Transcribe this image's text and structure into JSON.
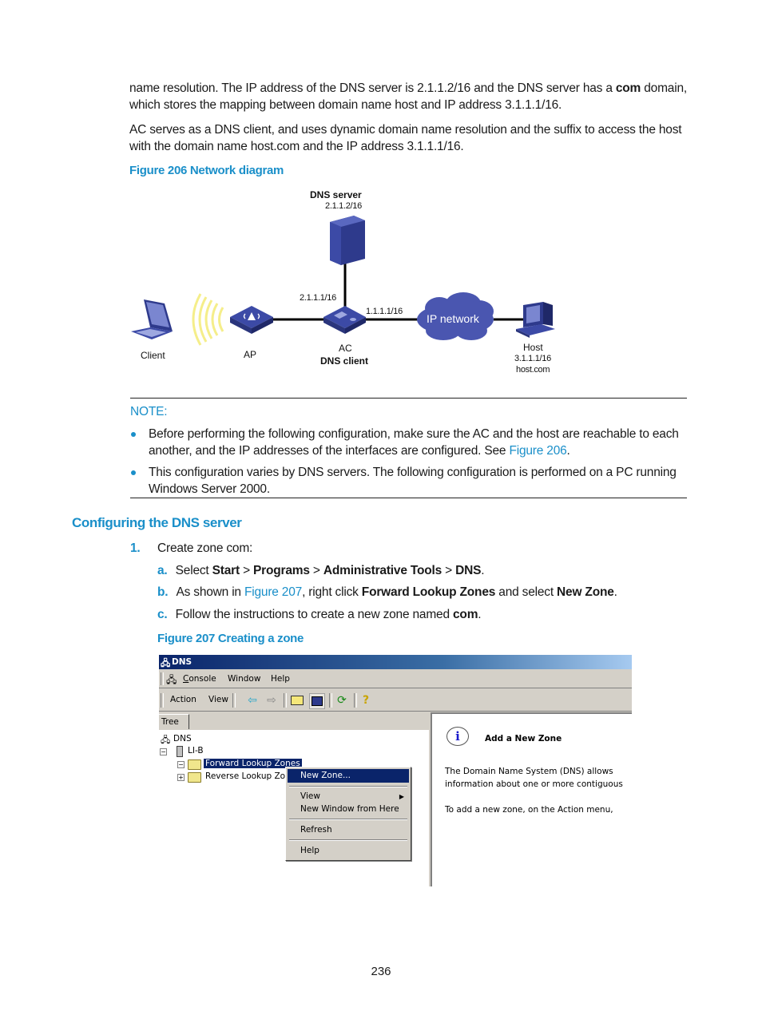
{
  "intro": {
    "p1_a": "name resolution. The IP address of the DNS server is 2.1.1.2/16 and the DNS server has a ",
    "p1_bold": "com",
    "p1_b": " domain,",
    "p1_line2": "which stores the mapping between domain name host and IP address 3.1.1.1/16.",
    "p2_line1": "AC serves as a DNS client, and uses dynamic domain name resolution and the suffix to access the host",
    "p2_line2": "with the domain name host.com and the IP address 3.1.1.1/16."
  },
  "figure206": {
    "caption": "Figure 206 Network diagram",
    "dns_server_label": "DNS server",
    "dns_server_ip": "2.1.1.2/16",
    "ac_ip_left": "2.1.1.1/16",
    "ac_ip_right": "1.1.1.1/16",
    "cloud_label": "IP network",
    "client_label": "Client",
    "ap_label": "AP",
    "ac_label": "AC",
    "ac_role": "DNS client",
    "host_label": "Host",
    "host_ip": "3.1.1.1/16",
    "host_name": "host.com"
  },
  "note": {
    "title": "NOTE:",
    "bullet1_line1": "Before performing the following configuration, make sure the AC and the host are reachable to each",
    "bullet1_line2_a": "another, and the IP addresses of the interfaces are configured. See ",
    "bullet1_link": "Figure 206",
    "bullet1_line2_b": ".",
    "bullet2_line1": "This configuration varies by DNS servers. The following configuration is performed on a PC running",
    "bullet2_line2": "Windows Server 2000."
  },
  "section": {
    "heading": "Configuring the DNS server",
    "step1_num": "1.",
    "step1_text": "Create zone com:",
    "a_num": "a.",
    "a_pre": "Select ",
    "a_start": "Start",
    "a_gt1": " > ",
    "a_programs": "Programs",
    "a_gt2": " > ",
    "a_tools": "Administrative Tools",
    "a_gt3": " > ",
    "a_dns": "DNS",
    "a_end": ".",
    "b_num": "b.",
    "b_pre": "As shown in ",
    "b_link": "Figure 207",
    "b_mid": ", right click ",
    "b_flz": "Forward Lookup Zones",
    "b_and": " and select ",
    "b_newzone": "New Zone",
    "b_end": ".",
    "c_num": "c.",
    "c_pre": "Follow the instructions to create a new zone named ",
    "c_com": "com",
    "c_end": "."
  },
  "figure207": {
    "caption": "Figure 207 Creating a zone",
    "window_title": "DNS",
    "menu": {
      "console": "Console",
      "window": "Window",
      "help": "Help"
    },
    "toolbar": {
      "action": "Action",
      "view": "View"
    },
    "tree_tab": "Tree",
    "tree": {
      "root": "DNS",
      "server": "LI-B",
      "forward": "Forward Lookup Zones",
      "reverse": "Reverse Lookup Zones"
    },
    "context_menu": {
      "new_zone": "New Zone...",
      "view": "View",
      "new_window": "New Window from Here",
      "refresh": "Refresh",
      "help": "Help"
    },
    "right_pane": {
      "title": "Add a New Zone",
      "line1": "The Domain Name System (DNS) allows",
      "line2": "information about one or more contiguous",
      "line3": "To add a new zone, on the Action menu,"
    }
  },
  "page_number": "236"
}
